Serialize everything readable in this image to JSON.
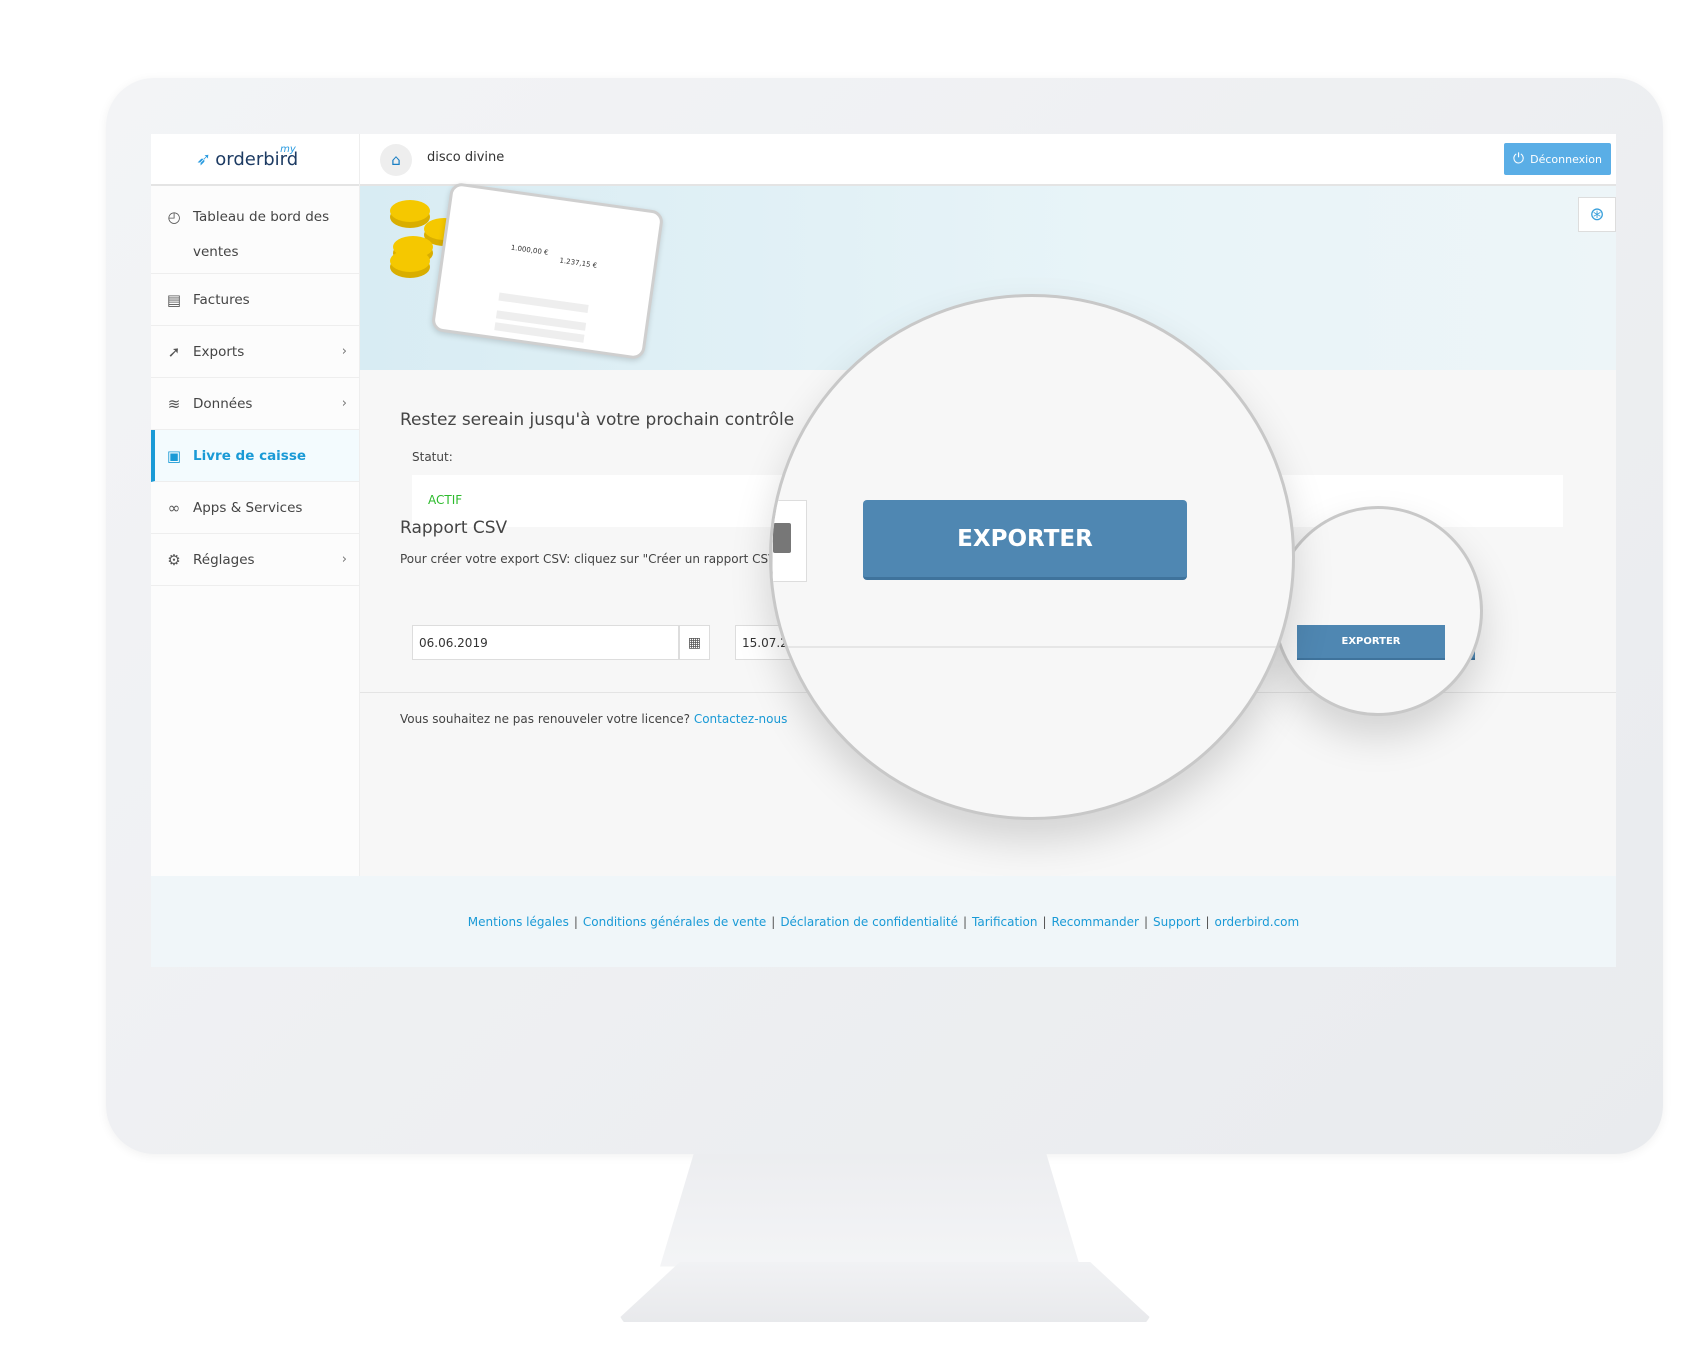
{
  "brand": {
    "logo": "orderbird",
    "logo_prefix": "my",
    "accent": "#1a9ad6"
  },
  "header": {
    "store_name": "disco divine",
    "logout_label": "Déconnexion",
    "logout_icon": "power-icon",
    "help_icon": "lifebuoy-icon"
  },
  "sidebar": {
    "items": [
      {
        "label": "Tableau de bord des ventes",
        "icon": "gauge-icon"
      },
      {
        "label": "Factures",
        "icon": "document-icon"
      },
      {
        "label": "Exports",
        "icon": "export-icon",
        "chevron": "›"
      },
      {
        "label": "Données",
        "icon": "layers-icon",
        "chevron": "›"
      },
      {
        "label": "Livre de caisse",
        "icon": "cashbook-icon",
        "active": true
      },
      {
        "label": "Apps & Services",
        "icon": "rings-icon"
      },
      {
        "label": "Réglages",
        "icon": "gear-icon",
        "chevron": "›"
      }
    ]
  },
  "banner": {
    "tablet_amount_1": "1.000,00 €",
    "tablet_amount_2": "1.237,15 €"
  },
  "main": {
    "title": "Restez sereain jusqu'à votre prochain contrôle",
    "status_label": "Statut:",
    "status_value": "ACTIF",
    "status_color": "#2dbb2d",
    "csv_title": "Rapport CSV",
    "csv_description": "Pour créer votre export CSV: cliquez sur \"Créer un rapport CSV\", c",
    "date_from": "06.06.2019",
    "date_to": "15.07.2019",
    "export_label": "EXPORTER",
    "notice_text": "Vous souhaitez ne pas renouveler votre licence?",
    "notice_link": "Contactez-nous"
  },
  "magnifier": {
    "export_label": "EXPORTER"
  },
  "footer": {
    "links": [
      "Mentions légales",
      "Conditions générales de vente",
      "Déclaration de confidentialité",
      "Tarification",
      "Recommander",
      "Support",
      "orderbird.com"
    ]
  }
}
